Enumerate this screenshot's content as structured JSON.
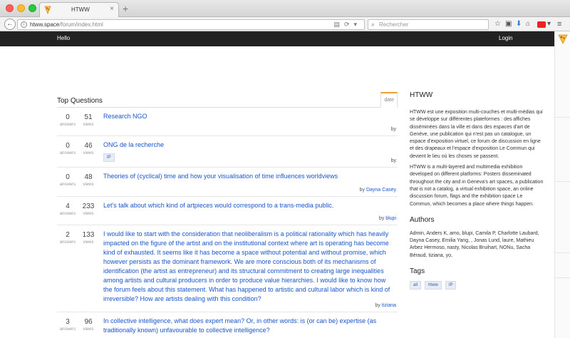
{
  "browser": {
    "tab_title": "HTWW",
    "new_tab": "+",
    "tab_close": "×",
    "url_host": "htww.space",
    "url_path": "/forum/index.html",
    "search_placeholder": "Rechercher",
    "back": "←"
  },
  "site_nav": {
    "left": "Hello",
    "right": "Login"
  },
  "main": {
    "title": "Top Questions",
    "sort_tab": "date",
    "answers_label": "answers",
    "views_label": "views",
    "by_label": "by",
    "questions": [
      {
        "answers": "0",
        "views": "51",
        "title": "Research NGO",
        "tag": "",
        "author": ""
      },
      {
        "answers": "0",
        "views": "46",
        "title": "ONG de la recherche",
        "tag": "IP",
        "author": ""
      },
      {
        "answers": "0",
        "views": "48",
        "title": "Theories of (cyclical) time and how your visualisation of time influences worldviews",
        "tag": "",
        "author": "Dayna Casey"
      },
      {
        "answers": "4",
        "views": "233",
        "title": "Let's talk about which kind of artpieces would correspond to a trans-media public.",
        "tag": "",
        "author": "blupi"
      },
      {
        "answers": "2",
        "views": "133",
        "title": "I would like to start with the consideration that neoliberalism is a political rationality which has heavily impacted on the figure of the artist and on the institutional context where art is operating has become kind of exhausted. It seems like it has become a space without potential and without promise, which however persists as the dominant framework. We are more conscious both of its mechanisms of identification (the artist as entrepreneur) and its structural commitment to creating large inequalities among artists and cultural producers in order to produce value hierarchies. I would like to know how the forum feels about this statement. What has happened to artistic and cultural labor which is kind of irreversible? How are artists dealing with this condition?",
        "tag": "",
        "author": "tiziana"
      },
      {
        "answers": "3",
        "views": "96",
        "title": "In collective intelligence, what does expert mean? Or, in other words: is (or can be) expertise (as traditionally known) unfavourable to collective intelligence?",
        "tag": "",
        "author": ""
      }
    ]
  },
  "sidebar": {
    "heading": "HTWW",
    "desc_fr": "HTWW est une exposition multi-couches et multi-médias qui se développe sur différentes plateformes : des affiches disséminées dans la ville et dans des espaces d'art de Genève, une publication qui n'est pas un catalogue, un espace d'exposition virtuel, ce forum de discussion en ligne et des drapeaux et l'espace d'exposition Le Commun qui devient le lieu où les choses se passent.",
    "desc_en": "HTWW is a multi-layered and multimedia exhibition developed on different platforms: Posters disseminated throughout the city and in Geneva's art spaces, a publication that is not a catalog, a virtual exhibition space, an online discussion forum, flags and the exhibition space Le Commun, which becomes a place where things happen.",
    "authors_heading": "Authors",
    "authors": "Admin, Anders K, amo, blupi, Camila P, Charlotte Laubard, Dayna Casey, Emilia Yang, , Jonas Lund, laure, Mathieu Arbez Hermoso, nasty, Nicolas Bruihart, NONu, Sacha Béraud, tiziana, yo,",
    "tags_heading": "Tags",
    "tags": [
      "all",
      "htww",
      "IP"
    ]
  }
}
